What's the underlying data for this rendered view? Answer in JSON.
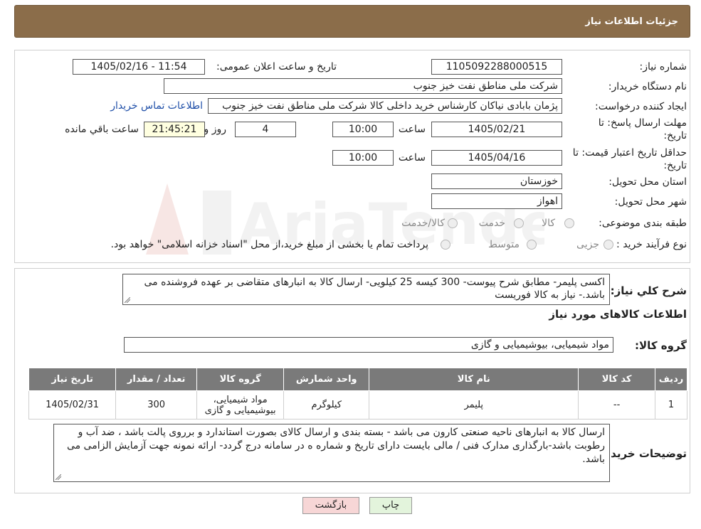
{
  "header": {
    "title": "جزئیات اطلاعات نیاز"
  },
  "form": {
    "need_number_label": "شماره نیاز:",
    "need_number": "1105092288000515",
    "announce_label": "تاریخ و ساعت اعلان عمومی:",
    "announce_value": "1405/02/16 - 11:54",
    "buyer_org_label": "نام دستگاه خریدار:",
    "buyer_org": "شرکت ملی مناطق نفت خیز جنوب",
    "creator_label": "ایجاد کننده درخواست:",
    "creator": "پژمان  بابادی نیاکان  کارشناس خرید داخلی کالا  شرکت ملی مناطق نفت خیز جنوب",
    "contact_link": "اطلاعات تماس خریدار",
    "deadline_label": "مهلت ارسال پاسخ: تا تاریخ:",
    "deadline_date": "1405/02/21",
    "time_label": "ساعت",
    "deadline_time": "10:00",
    "days_value": "4",
    "days_label": "روز و",
    "remaining_value": "21:45:21",
    "remaining_label": "ساعت باقي مانده",
    "validity_label": "حداقل تاریخ اعتبار قیمت: تا تاریخ:",
    "validity_date": "1405/04/16",
    "validity_time": "10:00",
    "province_label": "استان محل تحویل:",
    "province": "خوزستان",
    "city_label": "شهر محل تحویل:",
    "city": "اهواز",
    "category_label": "طبقه بندی موضوعی:",
    "category_options": [
      "کالا",
      "خدمت",
      "کالا/خدمت"
    ],
    "process_label": "نوع فرآیند خرید :",
    "process_options": [
      "جزیی",
      "متوسط"
    ],
    "payment_note": "پرداخت تمام یا بخشی از مبلغ خرید،از محل \"اسناد خزانه اسلامی\" خواهد بود."
  },
  "details": {
    "summary_label": "شرح کلي نياز:",
    "summary": "اکسی پلیمر- مطابق شرح پیوست- 300 کیسه 25 کیلویی- ارسال کالا به انبارهای متقاضی بر عهده فروشنده می باشد.- نیاز به کالا فوریست",
    "goods_info_title": "اطلاعات کالاهای مورد نیاز",
    "goods_group_label": "گروه کالا:",
    "goods_group": "مواد شیمیایی، بیوشیمیایی و  گازی",
    "table": {
      "headers": [
        "ردیف",
        "کد کالا",
        "نام کالا",
        "واحد شمارش",
        "گروه کالا",
        "تعداد / مقدار",
        "تاریخ نیاز"
      ],
      "rows": [
        [
          "1",
          "--",
          "پلیمر",
          "کیلوگرم",
          "مواد شیمیایی، بیوشیمیایی و گازی",
          "300",
          "1405/02/31"
        ]
      ]
    },
    "buyer_notes_label": "توضیحات خریدار:",
    "buyer_notes": "ارسال کالا به انبارهای  ناحیه صنعتی  کارون می باشد  - بسته بندی و ارسال کالای بصورت استاندارد و برروی پالت باشد ، ضد آب و رطوبت باشد-بارگذاری مدارک فنی / مالی بایست دارای تاریخ و شماره ه در سامانه درج گردد- ارائه نمونه جهت آزمایش الزامی می باشد."
  },
  "buttons": {
    "print": "چاپ",
    "back": "بازگشت"
  },
  "colors": {
    "header_bg": "#8b6d4a",
    "table_header_bg": "#7a7a7a",
    "link": "#1f4fa8",
    "back_btn_bg": "#f7d6d6",
    "print_btn_bg": "#e3f4dc"
  }
}
